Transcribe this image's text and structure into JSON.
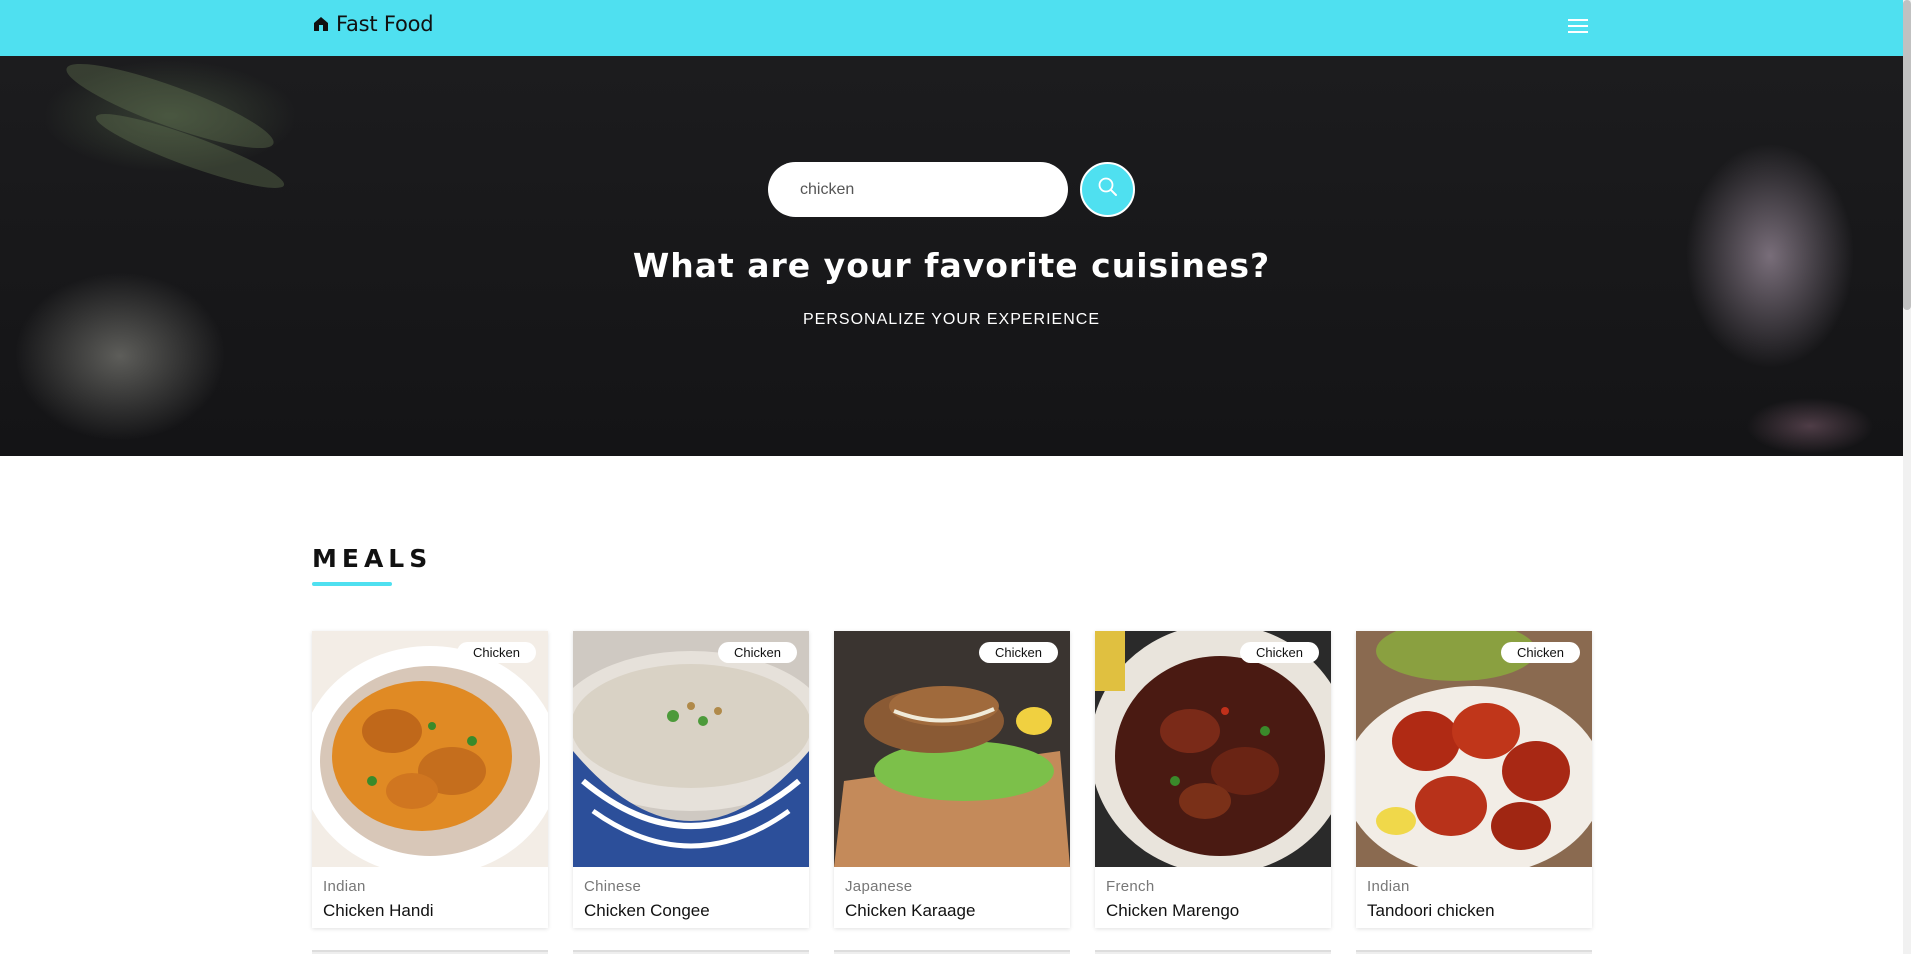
{
  "navbar": {
    "brand_icon": "home-icon",
    "brand_text": "Fast Food",
    "menu_icon": "hamburger-menu-icon",
    "accent_color": "#4fe0f0"
  },
  "hero": {
    "search": {
      "value": "chicken",
      "button_icon": "search-icon"
    },
    "title": "What are your favorite cuisines?",
    "subtitle": "PERSONALIZE YOUR EXPERIENCE"
  },
  "meals": {
    "heading": "MEALS",
    "cards": [
      {
        "tag": "Chicken",
        "cuisine": "Indian",
        "title": "Chicken Handi",
        "image": "chicken-handi-photo"
      },
      {
        "tag": "Chicken",
        "cuisine": "Chinese",
        "title": "Chicken Congee",
        "image": "chicken-congee-photo"
      },
      {
        "tag": "Chicken",
        "cuisine": "Japanese",
        "title": "Chicken Karaage",
        "image": "chicken-karaage-photo"
      },
      {
        "tag": "Chicken",
        "cuisine": "French",
        "title": "Chicken Marengo",
        "image": "chicken-marengo-photo"
      },
      {
        "tag": "Chicken",
        "cuisine": "Indian",
        "title": "Tandoori chicken",
        "image": "tandoori-chicken-photo"
      }
    ]
  }
}
